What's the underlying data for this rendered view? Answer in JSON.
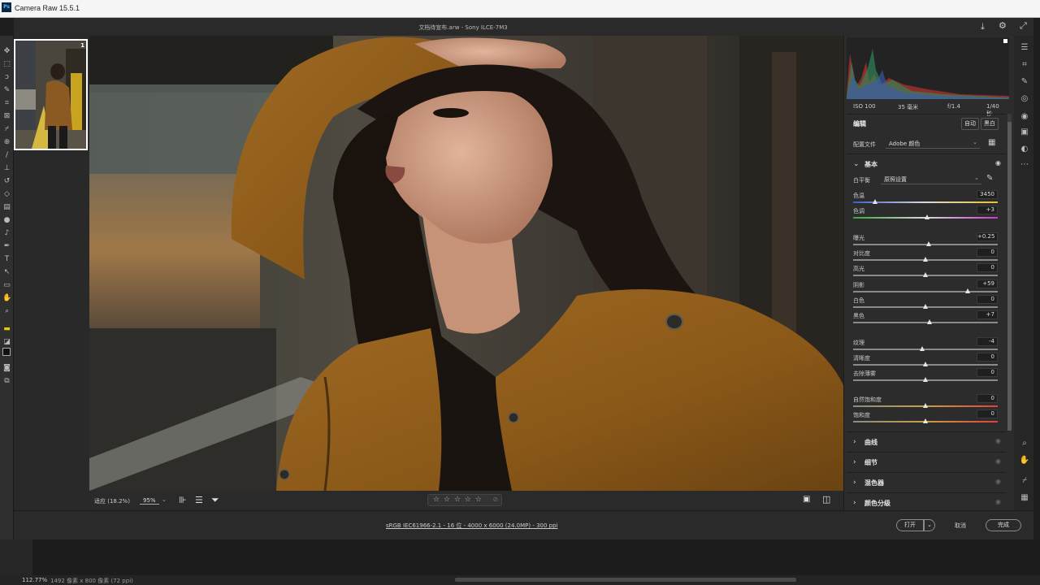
{
  "window": {
    "title": "Camera Raw 15.5.1",
    "app_badge": "Ps"
  },
  "file": {
    "label": "文档待宣布.arw - Sony ILCE-7M3"
  },
  "histogram": {
    "iso": "ISO 100",
    "focal": "35 毫米",
    "aperture": "f/1.4",
    "shutter": "1/40 秒"
  },
  "edit": {
    "title": "编辑",
    "auto_label": "自动",
    "bw_label": "黑白",
    "profile_label": "配置文件",
    "profile_value": "Adobe 颜色",
    "basic": {
      "title": "基本",
      "wb_label": "白平衡",
      "wb_value": "原照设置",
      "sliders": [
        {
          "name": "色温",
          "value": "3450",
          "pos": 0.15,
          "gradient": "temp"
        },
        {
          "name": "色调",
          "value": "+3",
          "pos": 0.51,
          "gradient": "tint"
        },
        {
          "name": "曝光",
          "value": "+0.25",
          "pos": 0.52,
          "gradient": "gray"
        },
        {
          "name": "对比度",
          "value": "0",
          "pos": 0.5,
          "gradient": "gray"
        },
        {
          "name": "高光",
          "value": "0",
          "pos": 0.5,
          "gradient": "gray"
        },
        {
          "name": "阴影",
          "value": "+59",
          "pos": 0.79,
          "gradient": "gray"
        },
        {
          "name": "白色",
          "value": "0",
          "pos": 0.5,
          "gradient": "gray"
        },
        {
          "name": "黑色",
          "value": "+7",
          "pos": 0.53,
          "gradient": "gray"
        },
        {
          "name": "纹理",
          "value": "-4",
          "pos": 0.48,
          "gradient": "gray"
        },
        {
          "name": "清晰度",
          "value": "0",
          "pos": 0.5,
          "gradient": "gray"
        },
        {
          "name": "去除薄雾",
          "value": "0",
          "pos": 0.5,
          "gradient": "gray"
        },
        {
          "name": "自然饱和度",
          "value": "0",
          "pos": 0.5,
          "gradient": "sat"
        },
        {
          "name": "饱和度",
          "value": "0",
          "pos": 0.5,
          "gradient": "sat"
        }
      ]
    },
    "sections": [
      "曲线",
      "细节",
      "混色器",
      "颜色分级"
    ]
  },
  "view": {
    "fit_label": "适应 (18.2%)",
    "zoom_value": "95%",
    "stars": "☆ ☆ ☆ ☆ ☆"
  },
  "footer": {
    "info_link": "sRGB IEC61966-2.1 - 16 位 - 4000 x 6000 (24.0MP) - 300 ppi",
    "open_label": "打开",
    "cancel_label": "取消",
    "done_label": "完成"
  },
  "status": {
    "zoom": "112.77%",
    "dims": "1492 像素 x 800 像素 (72 ppi)"
  },
  "colors": {
    "accent": "#2c2c2c",
    "thumb_border": "#ffffff"
  }
}
